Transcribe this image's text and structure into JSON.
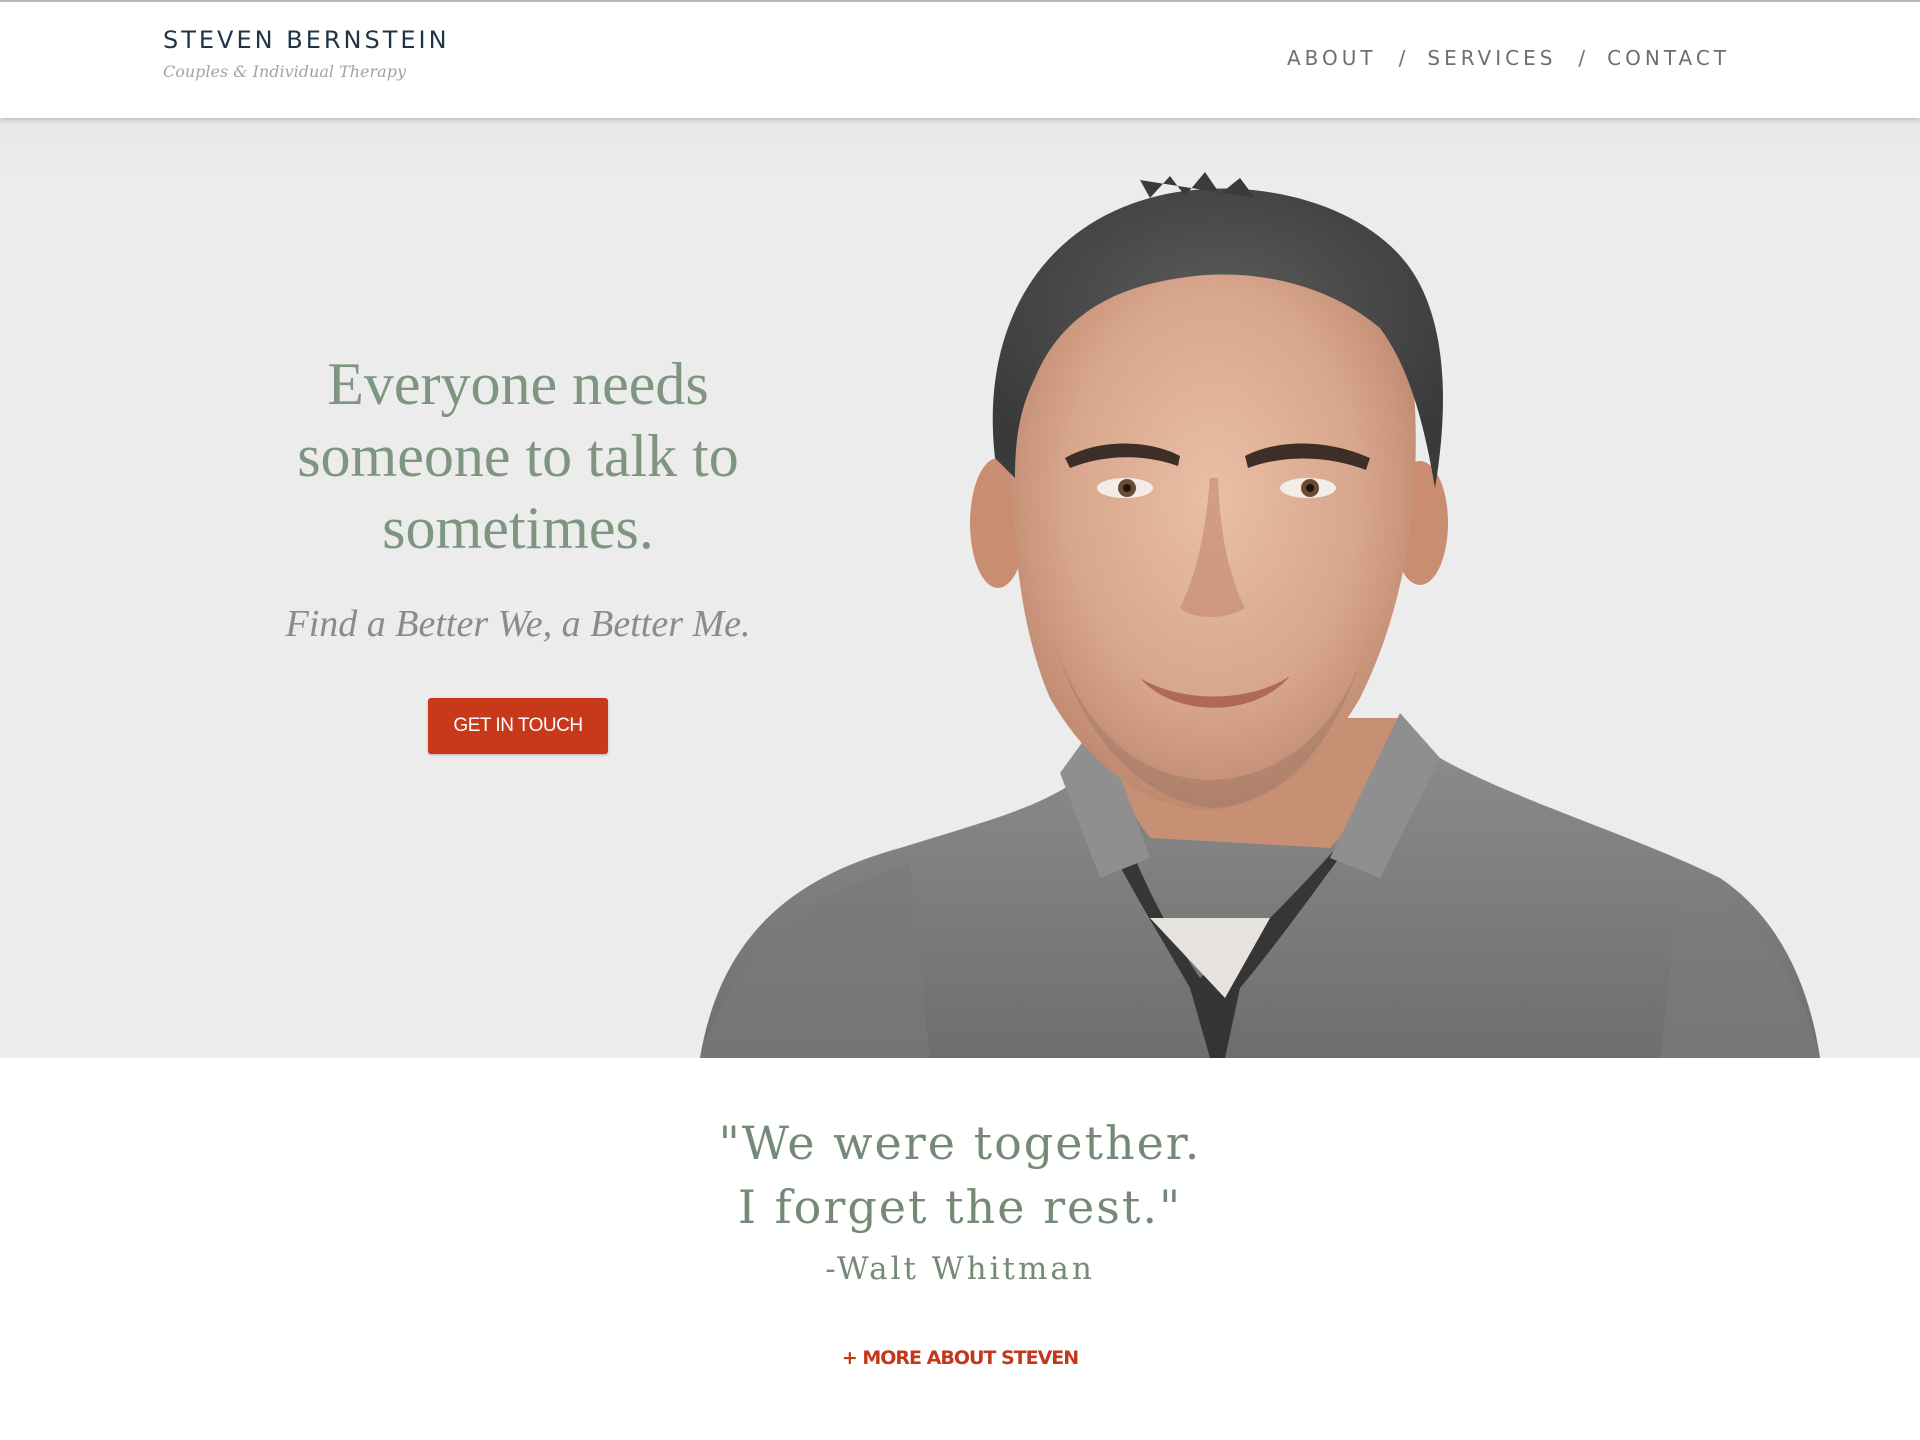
{
  "brand": {
    "name": "STEVEN BERNSTEIN",
    "tagline": "Couples & Individual Therapy"
  },
  "nav": {
    "items": [
      {
        "label": "ABOUT"
      },
      {
        "label": "SERVICES"
      },
      {
        "label": "CONTACT"
      }
    ],
    "separator": "/"
  },
  "hero": {
    "heading_lines": [
      "Everyone needs",
      "someone to talk to",
      "sometimes."
    ],
    "subheading": "Find a Better We, a Better Me.",
    "cta_label": "GET IN TOUCH"
  },
  "quote": {
    "lines": [
      "\"We were together.",
      "I forget the rest.\""
    ],
    "author": "-Walt Whitman",
    "more_link": "+ MORE ABOUT STEVEN"
  },
  "colors": {
    "brand_text": "#1f3547",
    "accent": "#c8381a",
    "heading_green": "#7e9580",
    "hero_background": "#ececec"
  }
}
